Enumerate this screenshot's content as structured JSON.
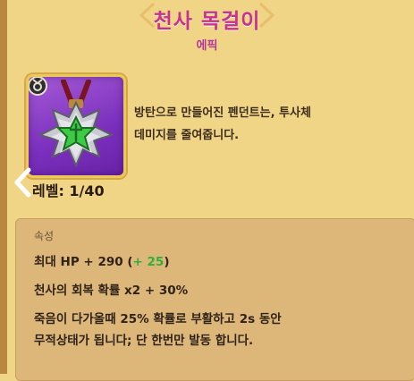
{
  "item": {
    "name": "천사 목걸이",
    "rarity": "에픽",
    "description_lines": [
      "방탄으로 만들어진 펜던트는, 투사체",
      "데미지를 줄여줍니다."
    ],
    "level": "레벨: 1/40"
  },
  "stats": {
    "header": "속성",
    "max_hp": {
      "base": "최대 HP + 290 (",
      "bonus": "+ 25",
      "close": ")"
    },
    "angel_recovery": "천사의 회복 확률 x2 + 30%",
    "death_line_1": "죽음이 다가올때 25% 확률로 부활하고 2s 동안",
    "death_line_2": "무적상태가 됩니다; 단 한번만 발동 합니다."
  },
  "colors": {
    "background": "#f1d587",
    "title": "#c7318f",
    "icon_bg": "#7a2fbd",
    "bonus_green": "#2db03c",
    "panel": "#ddb77a"
  },
  "icons": {
    "back": "chevron-left-icon",
    "item": "angel-necklace-icon",
    "tier": "tier-badge-icon"
  }
}
